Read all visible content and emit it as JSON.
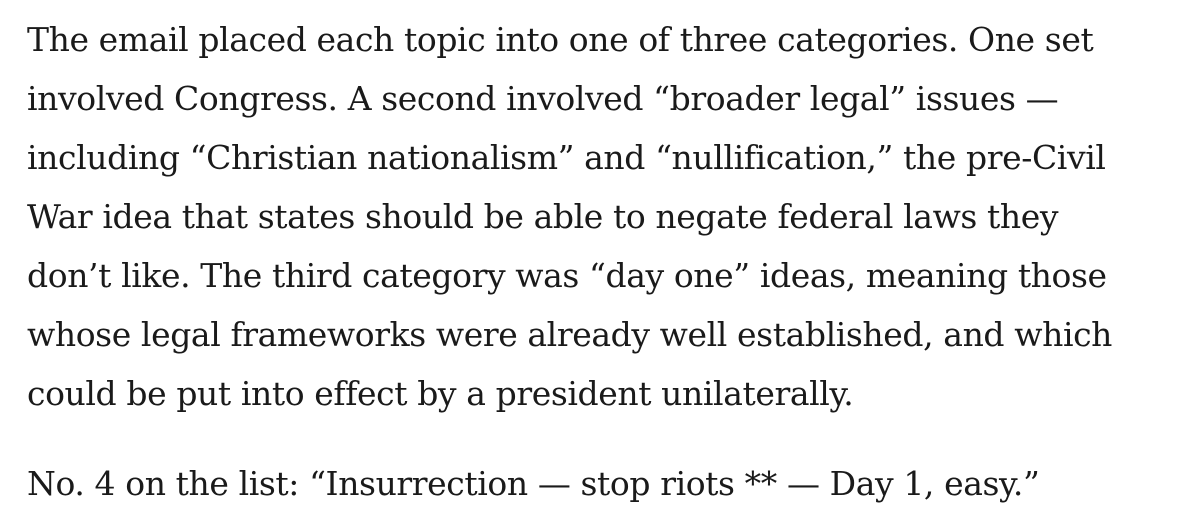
{
  "article": {
    "paragraphs": [
      {
        "lines": [
          "The email placed each topic into one of three categories. One set",
          "involved Congress. A second involved “broader legal” issues —",
          "including “Christian nationalism” and “nullification,” the pre-Civil",
          "War idea that states should be able to negate federal laws they",
          "don’t like. The third category was “day one” ideas, meaning those",
          "whose legal frameworks were already well established, and which",
          "could be put into effect by a president unilaterally."
        ]
      },
      {
        "lines": [
          "No. 4 on the list: “Insurrection — stop riots ** — Day 1, easy.”"
        ]
      }
    ]
  }
}
